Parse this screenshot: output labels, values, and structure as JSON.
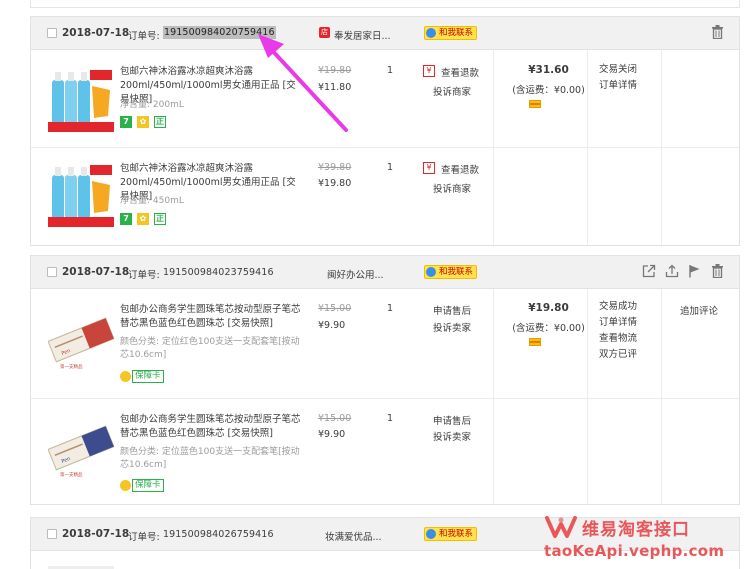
{
  "orders": [
    {
      "date": "2018-07-18",
      "order_label": "订单号:",
      "order_no": "191500984020759416",
      "shop_name": "奉发居家日...",
      "contact_label": "和我联系",
      "total": "¥31.60",
      "shipping": "(含运费：¥0.00)",
      "status_lines": [
        "交易关闭",
        "订单详情"
      ],
      "review": "",
      "items": [
        {
          "title": "包邮六神沐浴露冰凉超爽沐浴露200ml/450ml/1000ml男女通用正品 [交易快照]",
          "attr": "净含量: 200mL",
          "old_price": "¥19.80",
          "price": "¥11.80",
          "qty": "1",
          "svc1": "查看退款",
          "svc2": "投诉商家"
        },
        {
          "title": "包邮六神沐浴露冰凉超爽沐浴露200ml/450ml/1000ml男女通用正品 [交易快照]",
          "attr": "净含量: 450mL",
          "old_price": "¥39.80",
          "price": "¥19.80",
          "qty": "1",
          "svc1": "查看退款",
          "svc2": "投诉商家"
        }
      ]
    },
    {
      "date": "2018-07-18",
      "order_label": "订单号:",
      "order_no": "191500984023759416",
      "shop_name": "闽好办公用...",
      "contact_label": "和我联系",
      "total": "¥19.80",
      "shipping": "(含运费：¥0.00)",
      "status_lines": [
        "交易成功",
        "订单详情",
        "查看物流",
        "双方已评"
      ],
      "review": "追加评论",
      "items": [
        {
          "title": "包邮办公商务学生圆珠笔芯按动型原子笔芯替芯黑色蓝色红色圆珠芯 [交易快照]",
          "attr": "颜色分类: 定位红色100支送一支配套笔[按动芯10.6cm]",
          "badge": "保障卡",
          "old_price": "¥15.00",
          "price": "¥9.90",
          "qty": "1",
          "svc1": "申请售后",
          "svc2": "投诉卖家"
        },
        {
          "title": "包邮办公商务学生圆珠笔芯按动型原子笔芯替芯黑色蓝色红色圆珠芯 [交易快照]",
          "attr": "颜色分类: 定位蓝色100支送一支配套笔[按动芯10.6cm]",
          "badge": "保障卡",
          "old_price": "¥15.00",
          "price": "¥9.90",
          "qty": "1",
          "svc1": "申请售后",
          "svc2": "投诉卖家"
        }
      ]
    },
    {
      "date": "2018-07-18",
      "order_label": "订单号:",
      "order_no": "191500984026759416",
      "shop_name": "妆满爱优品...",
      "contact_label": "和我联系"
    }
  ],
  "watermark": {
    "title": "维易淘客接口",
    "url": "taoKeApi.vephp.com"
  },
  "colors": {
    "header_bg": "#f1f1f1",
    "contact_bg": "#ffe34d",
    "arrow": "#e83ae8",
    "watermark": "#e8585a",
    "guarantee_green": "#2bb14b"
  }
}
